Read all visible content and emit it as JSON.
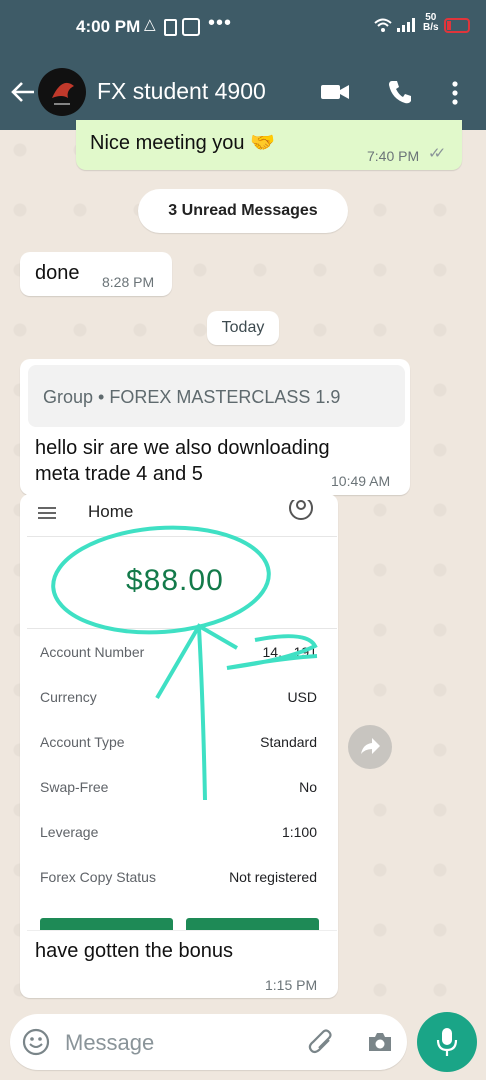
{
  "status_bar": {
    "time": "4:00 PM",
    "network_speed": "50",
    "network_unit": "B/s"
  },
  "header": {
    "contact_name": "FX student 4900"
  },
  "messages": {
    "first_out": {
      "text": "Nice meeting you 🤝",
      "time": "7:40 PM"
    },
    "unread_pill": "3 Unread Messages",
    "done_in": {
      "text": "done",
      "time": "8:28 PM"
    },
    "date_pill": "Today",
    "group_in": {
      "quote": "Group • FOREX MASTERCLASS 1.9",
      "text_line1": "hello sir are we also downloading",
      "text_line2": "meta trade 4 and 5",
      "time": "10:49 AM"
    },
    "image_in": {
      "screen_title": "Home",
      "balance": "$88.00",
      "rows": [
        {
          "label": "Account Number",
          "value": "14... 191"
        },
        {
          "label": "Currency",
          "value": "USD"
        },
        {
          "label": "Account Type",
          "value": "Standard"
        },
        {
          "label": "Swap-Free",
          "value": "No"
        },
        {
          "label": "Leverage",
          "value": "1:100"
        },
        {
          "label": "Forex Copy Status",
          "value": "Not registered"
        }
      ],
      "caption": "have gotten the bonus",
      "time": "1:15 PM"
    }
  },
  "composer": {
    "placeholder": "Message"
  },
  "colors": {
    "header": "#3e5b67",
    "accent": "#1aa587",
    "bubble_out": "#e1f9cb",
    "annotation": "#3fe0c4"
  }
}
